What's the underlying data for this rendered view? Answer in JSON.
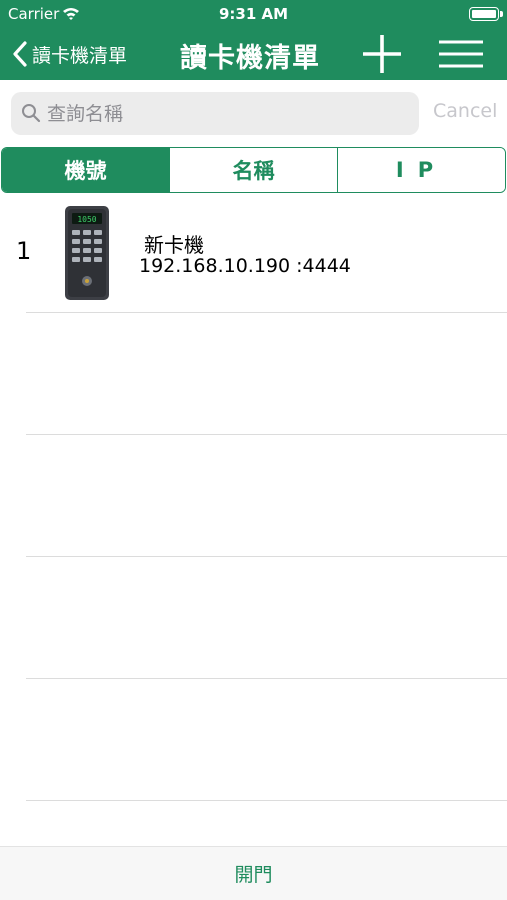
{
  "status_bar": {
    "carrier": "Carrier",
    "time": "9:31 AM"
  },
  "nav": {
    "back_label": "讀卡機清單",
    "title": "讀卡機清單"
  },
  "search": {
    "placeholder": "查詢名稱",
    "value": "",
    "cancel_label": "Cancel"
  },
  "segments": [
    {
      "label": "機號",
      "selected": true
    },
    {
      "label": "名稱",
      "selected": false
    },
    {
      "label": "IP",
      "selected": false
    }
  ],
  "devices": [
    {
      "number": "1",
      "name": "新卡機",
      "address": "192.168.10.190 :4444",
      "display_text": "1050"
    }
  ],
  "bottom_bar": {
    "open_door_label": "開門"
  },
  "colors": {
    "accent": "#1f8c5e",
    "separator": "#dcdcdc",
    "cancel": "#c7c7cc"
  }
}
